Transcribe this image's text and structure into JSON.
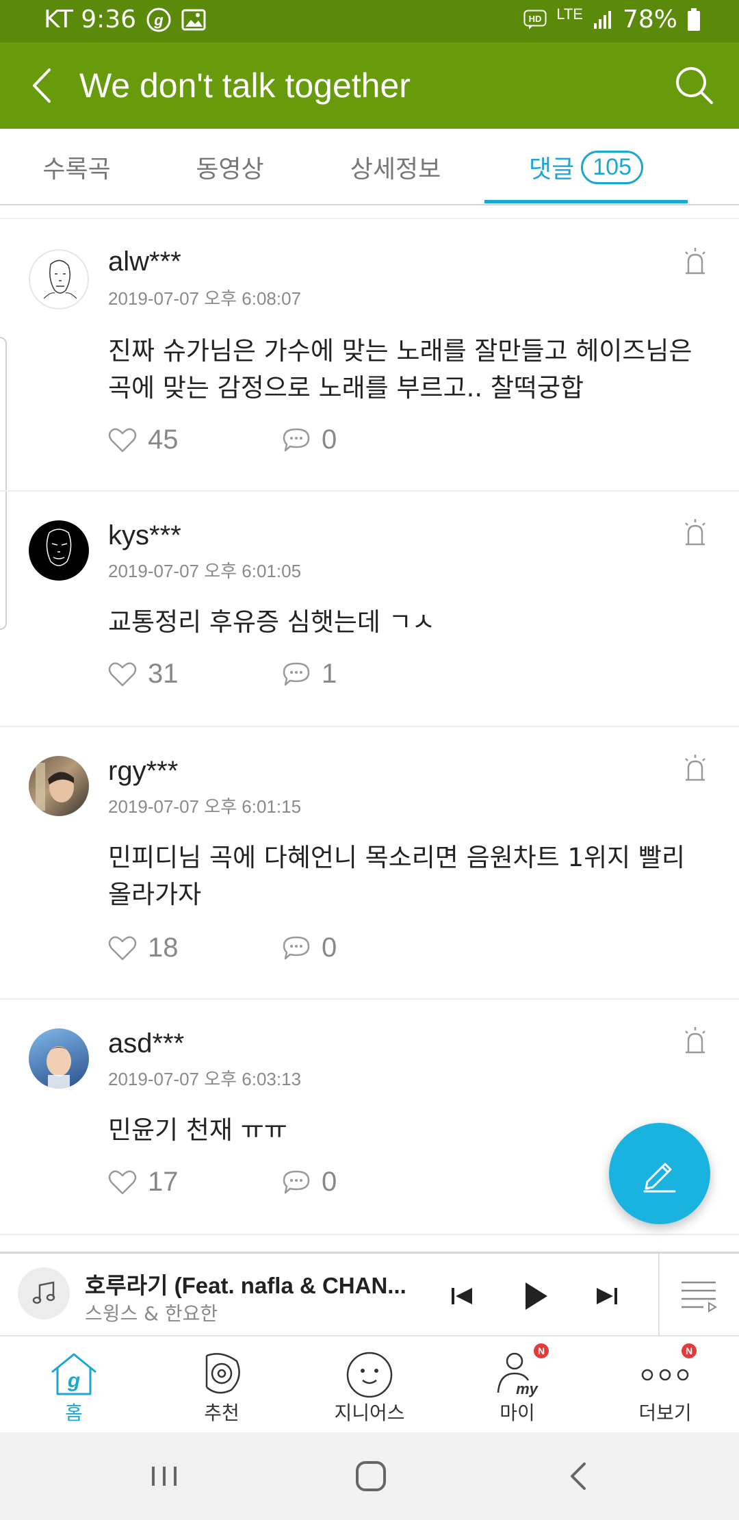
{
  "status_bar": {
    "carrier_time": "KT 9:36",
    "network": "LTE",
    "battery": "78%"
  },
  "app_bar": {
    "title": "We don't talk together"
  },
  "tabs": [
    {
      "label": "수록곡"
    },
    {
      "label": "동영상"
    },
    {
      "label": "상세정보"
    },
    {
      "label": "댓글",
      "count": "105",
      "active": true
    }
  ],
  "comments": [
    {
      "user": "alw***",
      "date": "2019-07-07 오후 6:08:07",
      "text": "진짜 슈가님은 가수에 맞는 노래를 잘만들고 헤이즈님은 곡에 맞는 감정으로 노래를 부르고.. 찰떡궁합",
      "likes": "45",
      "replies": "0"
    },
    {
      "user": "kys***",
      "date": "2019-07-07 오후 6:01:05",
      "text": "교통정리 후유증 심햇는데 ㄱㅅ",
      "likes": "31",
      "replies": "1"
    },
    {
      "user": "rgy***",
      "date": "2019-07-07 오후 6:01:15",
      "text": "민피디님 곡에 다혜언니 목소리면 음원차트 1위지 빨리 올라가자",
      "likes": "18",
      "replies": "0"
    },
    {
      "user": "asd***",
      "date": "2019-07-07 오후 6:03:13",
      "text": "민윤기 천재 ㅠㅠ",
      "likes": "17",
      "replies": "0"
    }
  ],
  "player": {
    "title": "호루라기 (Feat. nafla & CHAN...",
    "artist": "스윙스 & 한요한"
  },
  "bottom_nav": [
    {
      "label": "홈",
      "icon": "home-icon",
      "active": true
    },
    {
      "label": "추천",
      "icon": "recommend-icon"
    },
    {
      "label": "지니어스",
      "icon": "genius-icon"
    },
    {
      "label": "마이",
      "icon": "my-icon",
      "badge": "N"
    },
    {
      "label": "더보기",
      "icon": "more-icon",
      "badge": "N"
    }
  ],
  "colors": {
    "header": "#679b0b",
    "status_bar": "#5b8a0b",
    "accent": "#1aa7d1",
    "fab": "#1ab3e0",
    "badge": "#e23b3b"
  }
}
